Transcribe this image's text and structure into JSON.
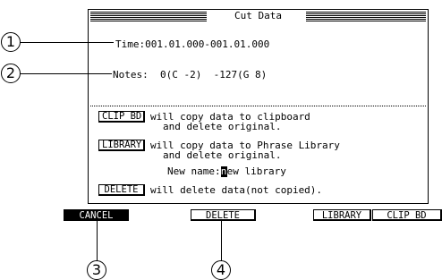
{
  "window": {
    "title": "Cut Data"
  },
  "fields": {
    "time_label": "Time:",
    "time_value": "001.01.000-001.01.000",
    "notes_label": "Notes:",
    "notes_value": "0(C -2)  -127(G 8)"
  },
  "options": {
    "clip_bd_button": "CLIP BD",
    "clip_bd_line1": "will copy data to clipboard",
    "clip_bd_line2": "and delete original.",
    "library_button": "LIBRARY",
    "library_line1": "will copy data to Phrase Library",
    "library_line2": "and delete original.",
    "new_name_label": "New name:",
    "new_name_cursor_char": "n",
    "new_name_rest": "ew library",
    "delete_button": "DELETE",
    "delete_text": "will delete data(not copied)."
  },
  "function_keys": {
    "cancel": "CANCEL",
    "delete": "DELETE",
    "library": "LIBRARY",
    "clip_bd": "CLIP BD"
  },
  "callouts": {
    "c1": "1",
    "c2": "2",
    "c3": "3",
    "c4": "4"
  }
}
